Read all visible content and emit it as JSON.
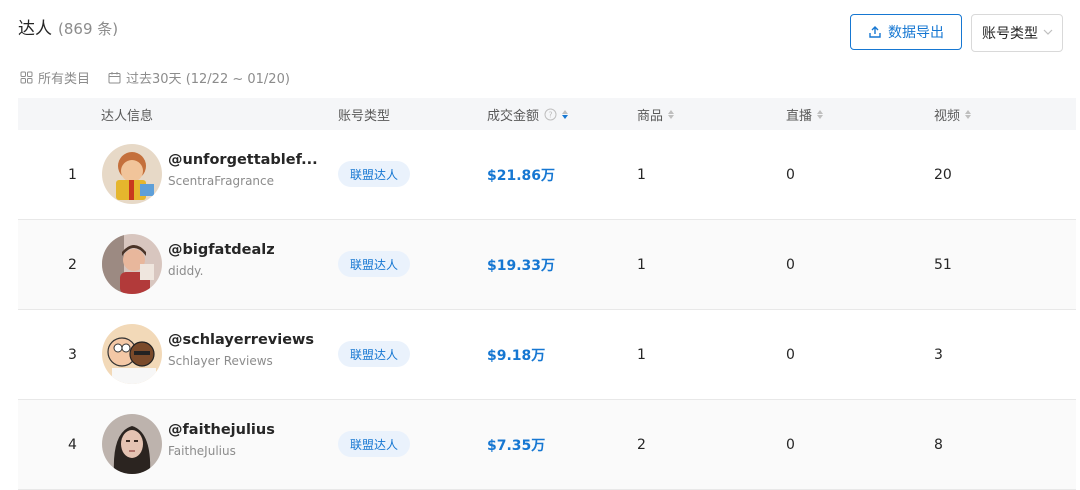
{
  "header": {
    "title": "达人",
    "count": "(869 条)"
  },
  "toolbar": {
    "export_label": "数据导出",
    "account_type_label": "账号类型"
  },
  "filters": {
    "category": "所有类目",
    "date_range": "过去30天 (12/22 ~ 01/20)"
  },
  "table": {
    "columns": {
      "info": "达人信息",
      "account_type": "账号类型",
      "gmv": "成交金额",
      "goods": "商品",
      "live": "直播",
      "video": "视频"
    },
    "rows": [
      {
        "rank": "1",
        "handle": "@unforgettablef...",
        "nickname": "ScentraFragrance",
        "type": "联盟达人",
        "gmv": "$21.86万",
        "goods": "1",
        "live": "0",
        "video": "20"
      },
      {
        "rank": "2",
        "handle": "@bigfatdealz",
        "nickname": "diddy.",
        "type": "联盟达人",
        "gmv": "$19.33万",
        "goods": "1",
        "live": "0",
        "video": "51"
      },
      {
        "rank": "3",
        "handle": "@schlayerreviews",
        "nickname": "Schlayer Reviews",
        "type": "联盟达人",
        "gmv": "$9.18万",
        "goods": "1",
        "live": "0",
        "video": "3"
      },
      {
        "rank": "4",
        "handle": "@faithejulius",
        "nickname": "FaitheJulius",
        "type": "联盟达人",
        "gmv": "$7.35万",
        "goods": "2",
        "live": "0",
        "video": "8"
      }
    ]
  },
  "colors": {
    "accent": "#1677d2",
    "badge_bg": "#eaf2fc",
    "header_bg": "#f5f6f8"
  },
  "icons": {
    "export": "upload-icon",
    "select": "chevron-down-icon",
    "category": "grid-icon",
    "date": "calendar-icon",
    "help": "question-circle-icon",
    "sort": "sort-caret-icon"
  }
}
